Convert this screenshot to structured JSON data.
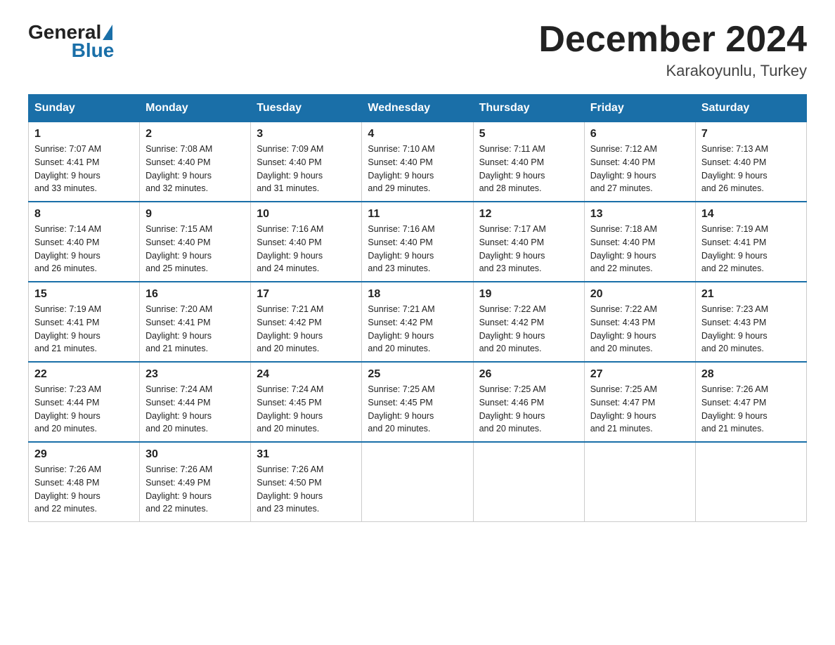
{
  "logo": {
    "general": "General",
    "blue": "Blue"
  },
  "title": "December 2024",
  "location": "Karakoyunlu, Turkey",
  "days_of_week": [
    "Sunday",
    "Monday",
    "Tuesday",
    "Wednesday",
    "Thursday",
    "Friday",
    "Saturday"
  ],
  "weeks": [
    [
      {
        "day": "1",
        "sunrise": "7:07 AM",
        "sunset": "4:41 PM",
        "daylight": "9 hours and 33 minutes."
      },
      {
        "day": "2",
        "sunrise": "7:08 AM",
        "sunset": "4:40 PM",
        "daylight": "9 hours and 32 minutes."
      },
      {
        "day": "3",
        "sunrise": "7:09 AM",
        "sunset": "4:40 PM",
        "daylight": "9 hours and 31 minutes."
      },
      {
        "day": "4",
        "sunrise": "7:10 AM",
        "sunset": "4:40 PM",
        "daylight": "9 hours and 29 minutes."
      },
      {
        "day": "5",
        "sunrise": "7:11 AM",
        "sunset": "4:40 PM",
        "daylight": "9 hours and 28 minutes."
      },
      {
        "day": "6",
        "sunrise": "7:12 AM",
        "sunset": "4:40 PM",
        "daylight": "9 hours and 27 minutes."
      },
      {
        "day": "7",
        "sunrise": "7:13 AM",
        "sunset": "4:40 PM",
        "daylight": "9 hours and 26 minutes."
      }
    ],
    [
      {
        "day": "8",
        "sunrise": "7:14 AM",
        "sunset": "4:40 PM",
        "daylight": "9 hours and 26 minutes."
      },
      {
        "day": "9",
        "sunrise": "7:15 AM",
        "sunset": "4:40 PM",
        "daylight": "9 hours and 25 minutes."
      },
      {
        "day": "10",
        "sunrise": "7:16 AM",
        "sunset": "4:40 PM",
        "daylight": "9 hours and 24 minutes."
      },
      {
        "day": "11",
        "sunrise": "7:16 AM",
        "sunset": "4:40 PM",
        "daylight": "9 hours and 23 minutes."
      },
      {
        "day": "12",
        "sunrise": "7:17 AM",
        "sunset": "4:40 PM",
        "daylight": "9 hours and 23 minutes."
      },
      {
        "day": "13",
        "sunrise": "7:18 AM",
        "sunset": "4:40 PM",
        "daylight": "9 hours and 22 minutes."
      },
      {
        "day": "14",
        "sunrise": "7:19 AM",
        "sunset": "4:41 PM",
        "daylight": "9 hours and 22 minutes."
      }
    ],
    [
      {
        "day": "15",
        "sunrise": "7:19 AM",
        "sunset": "4:41 PM",
        "daylight": "9 hours and 21 minutes."
      },
      {
        "day": "16",
        "sunrise": "7:20 AM",
        "sunset": "4:41 PM",
        "daylight": "9 hours and 21 minutes."
      },
      {
        "day": "17",
        "sunrise": "7:21 AM",
        "sunset": "4:42 PM",
        "daylight": "9 hours and 20 minutes."
      },
      {
        "day": "18",
        "sunrise": "7:21 AM",
        "sunset": "4:42 PM",
        "daylight": "9 hours and 20 minutes."
      },
      {
        "day": "19",
        "sunrise": "7:22 AM",
        "sunset": "4:42 PM",
        "daylight": "9 hours and 20 minutes."
      },
      {
        "day": "20",
        "sunrise": "7:22 AM",
        "sunset": "4:43 PM",
        "daylight": "9 hours and 20 minutes."
      },
      {
        "day": "21",
        "sunrise": "7:23 AM",
        "sunset": "4:43 PM",
        "daylight": "9 hours and 20 minutes."
      }
    ],
    [
      {
        "day": "22",
        "sunrise": "7:23 AM",
        "sunset": "4:44 PM",
        "daylight": "9 hours and 20 minutes."
      },
      {
        "day": "23",
        "sunrise": "7:24 AM",
        "sunset": "4:44 PM",
        "daylight": "9 hours and 20 minutes."
      },
      {
        "day": "24",
        "sunrise": "7:24 AM",
        "sunset": "4:45 PM",
        "daylight": "9 hours and 20 minutes."
      },
      {
        "day": "25",
        "sunrise": "7:25 AM",
        "sunset": "4:45 PM",
        "daylight": "9 hours and 20 minutes."
      },
      {
        "day": "26",
        "sunrise": "7:25 AM",
        "sunset": "4:46 PM",
        "daylight": "9 hours and 20 minutes."
      },
      {
        "day": "27",
        "sunrise": "7:25 AM",
        "sunset": "4:47 PM",
        "daylight": "9 hours and 21 minutes."
      },
      {
        "day": "28",
        "sunrise": "7:26 AM",
        "sunset": "4:47 PM",
        "daylight": "9 hours and 21 minutes."
      }
    ],
    [
      {
        "day": "29",
        "sunrise": "7:26 AM",
        "sunset": "4:48 PM",
        "daylight": "9 hours and 22 minutes."
      },
      {
        "day": "30",
        "sunrise": "7:26 AM",
        "sunset": "4:49 PM",
        "daylight": "9 hours and 22 minutes."
      },
      {
        "day": "31",
        "sunrise": "7:26 AM",
        "sunset": "4:50 PM",
        "daylight": "9 hours and 23 minutes."
      },
      null,
      null,
      null,
      null
    ]
  ]
}
